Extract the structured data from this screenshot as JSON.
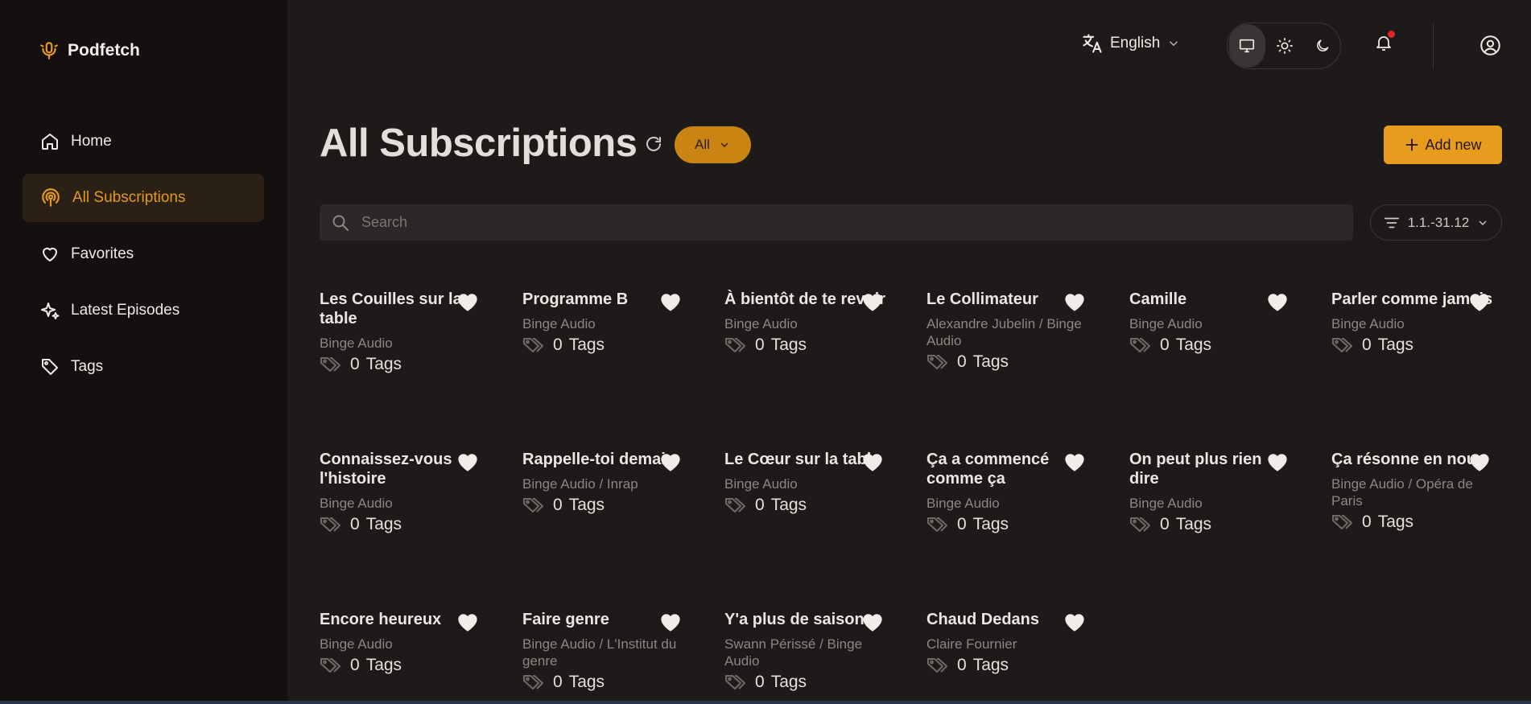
{
  "app": {
    "name": "Podfetch"
  },
  "nav": [
    {
      "label": "Home",
      "icon": "home-icon"
    },
    {
      "label": "All Subscriptions",
      "icon": "podcast-icon",
      "active": true
    },
    {
      "label": "Favorites",
      "icon": "heart-icon"
    },
    {
      "label": "Latest Episodes",
      "icon": "sparkles-icon"
    },
    {
      "label": "Tags",
      "icon": "tag-icon"
    }
  ],
  "topbar": {
    "language": "English",
    "theme_options": [
      "system",
      "light",
      "dark"
    ],
    "theme_selected": "system",
    "has_notification": true
  },
  "main": {
    "title": "All Subscriptions",
    "filter": "All",
    "add_label": "Add new",
    "search_placeholder": "Search",
    "sort_label": "1.1.-31.12"
  },
  "podcasts": [
    {
      "title": "Les Couilles sur la table",
      "author": "Binge Audio",
      "tags": "0",
      "tags_label": "Tags"
    },
    {
      "title": "Programme B",
      "author": "Binge Audio",
      "tags": "0",
      "tags_label": "Tags"
    },
    {
      "title": "À bientôt de te revoir",
      "author": "Binge Audio",
      "tags": "0",
      "tags_label": "Tags"
    },
    {
      "title": "Le Collimateur",
      "author": "Alexandre Jubelin / Binge Audio",
      "tags": "0",
      "tags_label": "Tags"
    },
    {
      "title": "Camille",
      "author": "Binge Audio",
      "tags": "0",
      "tags_label": "Tags"
    },
    {
      "title": "Parler comme jamais",
      "author": "Binge Audio",
      "tags": "0",
      "tags_label": "Tags"
    },
    {
      "title": "Connaissez-vous l'histoire",
      "author": "Binge Audio",
      "tags": "0",
      "tags_label": "Tags"
    },
    {
      "title": "Rappelle-toi demain",
      "author": "Binge Audio / Inrap",
      "tags": "0",
      "tags_label": "Tags"
    },
    {
      "title": "Le Cœur sur la table",
      "author": "Binge Audio",
      "tags": "0",
      "tags_label": "Tags"
    },
    {
      "title": "Ça a commencé comme ça",
      "author": "Binge Audio",
      "tags": "0",
      "tags_label": "Tags"
    },
    {
      "title": "On peut plus rien dire",
      "author": "Binge Audio",
      "tags": "0",
      "tags_label": "Tags"
    },
    {
      "title": "Ça résonne en nous",
      "author": "Binge Audio / Opéra de Paris",
      "tags": "0",
      "tags_label": "Tags"
    },
    {
      "title": "Encore heureux",
      "author": "Binge Audio",
      "tags": "0",
      "tags_label": "Tags"
    },
    {
      "title": "Faire genre",
      "author": "Binge Audio / L'Institut du genre",
      "tags": "0",
      "tags_label": "Tags"
    },
    {
      "title": "Y'a plus de saison",
      "author": "Swann Périssé / Binge Audio",
      "tags": "0",
      "tags_label": "Tags"
    },
    {
      "title": "Chaud Dedans",
      "author": "Claire Fournier",
      "tags": "0",
      "tags_label": "Tags"
    }
  ],
  "colors": {
    "accent": "#e89c1e",
    "background": "#1e1a19",
    "sidebar": "#141010"
  }
}
